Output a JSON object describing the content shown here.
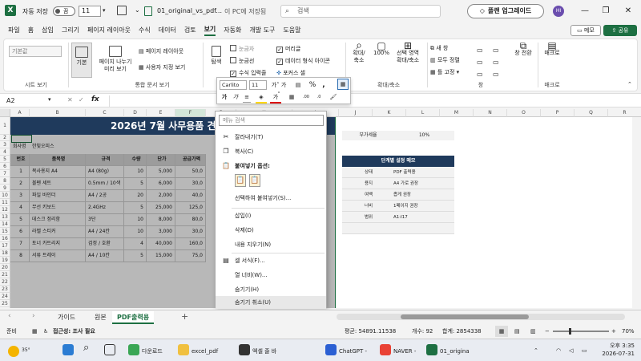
{
  "titlebar": {
    "autosave_label": "자동 저장",
    "autosave_state": "끔",
    "font_size": "11",
    "filename": "01_original_vs_pdf...",
    "location": "이 PC에 저장됨",
    "search_placeholder": "검색",
    "upgrade_label": "플랜 업그레이드",
    "avatar_initials": "HI"
  },
  "menu": {
    "tabs": [
      "파일",
      "홈",
      "삽입",
      "그리기",
      "페이지 레이아웃",
      "수식",
      "데이터",
      "검토",
      "보기",
      "자동화",
      "개발 도구",
      "도움말"
    ],
    "active_index": 8,
    "memo_label": "메모",
    "share_label": "공유"
  },
  "ribbon": {
    "sheetview_select": "기본값",
    "sheetview_group": "시트 보기",
    "normal_label": "기본",
    "pagebreak_label1": "페이지 나누기",
    "pagebreak_label2": "미리 보기",
    "pagelayout_label": "페이지 레이아웃",
    "customview_label": "사용자 지정 보기",
    "workbook_group": "통합 문서 보기",
    "navigation_label": "탐색",
    "ruler_label": "눈금자",
    "gridlines_label": "눈금선",
    "formulabar_label": "수식 입력줄",
    "headings_label": "머리글",
    "datafmt_label": "데이터 형식 아이콘",
    "focuscell_label": "포커스 셀",
    "zoom_label1": "확대/",
    "zoom_label2": "축소",
    "zoom100_label": "100%",
    "zoomsel_label1": "선택 영역",
    "zoomsel_label2": "확대/축소",
    "zoom_group": "확대/축소",
    "newwin_label": "새 창",
    "arrange_label": "모두 정렬",
    "freeze_label": "틀 고정",
    "switch_label": "창 전환",
    "window_group": "창",
    "macro_label": "매크로",
    "macro_group": "매크로"
  },
  "formula": {
    "namebox": "A2",
    "fx": "fx"
  },
  "sheet": {
    "columns": [
      "A",
      "B",
      "C",
      "D",
      "E",
      "F",
      "G",
      "H",
      "I",
      "J",
      "K",
      "L",
      "M",
      "N",
      "O",
      "P",
      "Q",
      "R",
      "S",
      "T"
    ],
    "rows": [
      "1",
      "2",
      "3",
      "4",
      "5",
      "6",
      "7",
      "8",
      "9",
      "10",
      "11",
      "12",
      "13",
      "14",
      "15",
      "16",
      "17",
      "18",
      "19",
      "20",
      "21",
      "22",
      "23",
      "24",
      "25",
      "26",
      "27"
    ],
    "title": "2026년 7월 사무용품 견",
    "company_label": "회사명",
    "company_value": "한빛오피스",
    "table_headers": [
      "번호",
      "품목명",
      "규격",
      "수량",
      "단가",
      "공급가액"
    ],
    "table_rows": [
      [
        "1",
        "복사용지 A4",
        "A4 (80g)",
        "10",
        "5,000",
        "50,0"
      ],
      [
        "2",
        "볼펜 세트",
        "0.5mm / 10색",
        "5",
        "6,000",
        "30,0"
      ],
      [
        "3",
        "파일 바인더",
        "A4 / 2공",
        "20",
        "2,000",
        "40,0"
      ],
      [
        "4",
        "무선 키보드",
        "2.4GHz",
        "5",
        "25,000",
        "125,0"
      ],
      [
        "5",
        "데스크 정리함",
        "3단",
        "10",
        "8,000",
        "80,0"
      ],
      [
        "6",
        "라벨 스티커",
        "A4 / 24칸",
        "10",
        "3,000",
        "30,0"
      ],
      [
        "7",
        "토너 카트리지",
        "검정 / 호환",
        "4",
        "40,000",
        "160,0"
      ],
      [
        "8",
        "서류 트레이",
        "A4 / 10칸",
        "5",
        "15,000",
        "75,0"
      ]
    ],
    "vat_label": "부가세율",
    "vat_value": "10%",
    "memo_title": "단계별 설정 메모",
    "memo_rows": [
      [
        "상태",
        "PDF 출력용"
      ],
      [
        "용지",
        "A4 가로 권장"
      ],
      [
        "여백",
        "좁게 권장"
      ],
      [
        "너비",
        "1페이지 권장"
      ],
      [
        "범위",
        "A1:I17"
      ]
    ]
  },
  "minitoolbar": {
    "font": "Carlito",
    "size": "11"
  },
  "context_menu": {
    "search_placeholder": "메뉴 검색",
    "cut": "잘라내기(T)",
    "copy": "복사(C)",
    "paste_options": "붙여넣기 옵션:",
    "paste_special": "선택하여 붙여넣기(S)...",
    "insert": "삽입(I)",
    "delete": "삭제(D)",
    "clear": "내용 지우기(N)",
    "format_cells": "셀 서식(F)...",
    "col_width": "열 너비(W)...",
    "hide": "숨기기(H)",
    "unhide": "숨기기 취소(U)"
  },
  "tabs": {
    "items": [
      "가이드",
      "원본",
      "PDF출력용"
    ],
    "active_index": 2
  },
  "status": {
    "ready": "준비",
    "accessibility": "접근성: 조사 필요",
    "average": "평균: 54891.11538",
    "count": "개수: 92",
    "sum": "합계: 2854338",
    "zoom": "70%"
  },
  "taskbar": {
    "weather": "35°",
    "items": [
      "다운로드",
      "excel_pdf",
      "엑셀 줄 바",
      "ChatGPT -",
      "NAVER -",
      "01_origina"
    ],
    "time": "오후 3:35",
    "date": "2026-07-31"
  },
  "colors": {
    "excel_green": "#1d6f42",
    "header_navy": "#1f3a5c"
  }
}
